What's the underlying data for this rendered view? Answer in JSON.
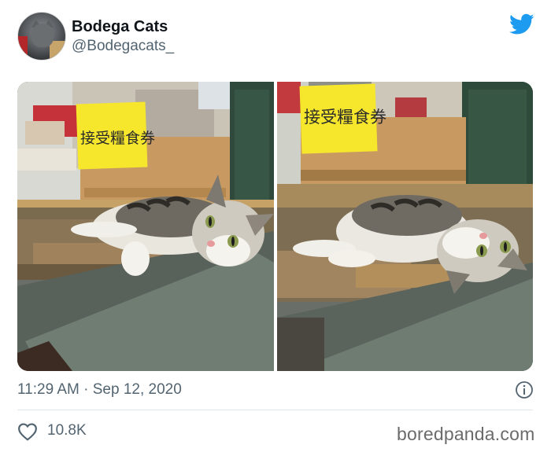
{
  "tweet": {
    "author": {
      "name": "Bodega Cats",
      "handle": "@Bodegacats_"
    },
    "icons": {
      "platform": "twitter-bird-icon",
      "info": "info-circle-icon",
      "like": "heart-outline-icon"
    },
    "colors": {
      "brand": "#1d9bf0",
      "secondary_text": "#536471",
      "sign_yellow": "#f6e72d"
    },
    "media": {
      "photos": [
        {
          "sign_text": "接受糧食券"
        },
        {
          "sign_text": "接受糧食券"
        }
      ]
    },
    "timestamp": "11:29 AM · Sep 12, 2020",
    "likes": "10.8K",
    "watermark": "boredpanda.com"
  }
}
